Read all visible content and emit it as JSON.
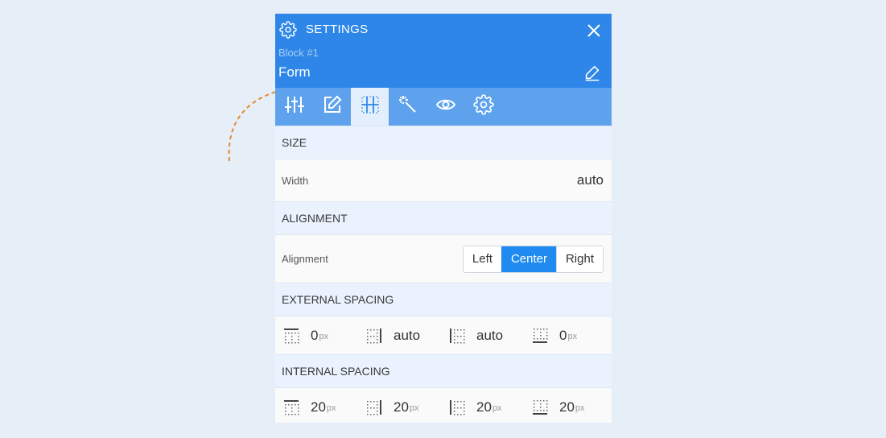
{
  "header": {
    "title": "SETTINGS",
    "block_id": "Block #1",
    "block_name": "Form"
  },
  "tabs": [
    {
      "icon": "sliders-icon",
      "active": false
    },
    {
      "icon": "edit-icon",
      "active": false
    },
    {
      "icon": "layout-grid-icon",
      "active": true
    },
    {
      "icon": "magic-wand-icon",
      "active": false
    },
    {
      "icon": "eye-icon",
      "active": false
    },
    {
      "icon": "gear-icon",
      "active": false
    }
  ],
  "size": {
    "heading": "SIZE",
    "width_label": "Width",
    "width_value": "auto"
  },
  "alignment": {
    "heading": "ALIGNMENT",
    "label": "Alignment",
    "options": [
      "Left",
      "Center",
      "Right"
    ],
    "selected": "Center"
  },
  "external_spacing": {
    "heading": "EXTERNAL SPACING",
    "top": "0",
    "top_unit": "px",
    "right": "auto",
    "left": "auto",
    "bottom": "0",
    "bottom_unit": "px"
  },
  "internal_spacing": {
    "heading": "INTERNAL SPACING",
    "top": "20",
    "top_unit": "px",
    "right": "20",
    "right_unit": "px",
    "left": "20",
    "left_unit": "px",
    "bottom": "20",
    "bottom_unit": "px"
  },
  "colors": {
    "header_bg": "#2e87e8",
    "tabs_bg": "#5ea2ee",
    "accent": "#1f8bf0",
    "arrow": "#e8892f"
  }
}
